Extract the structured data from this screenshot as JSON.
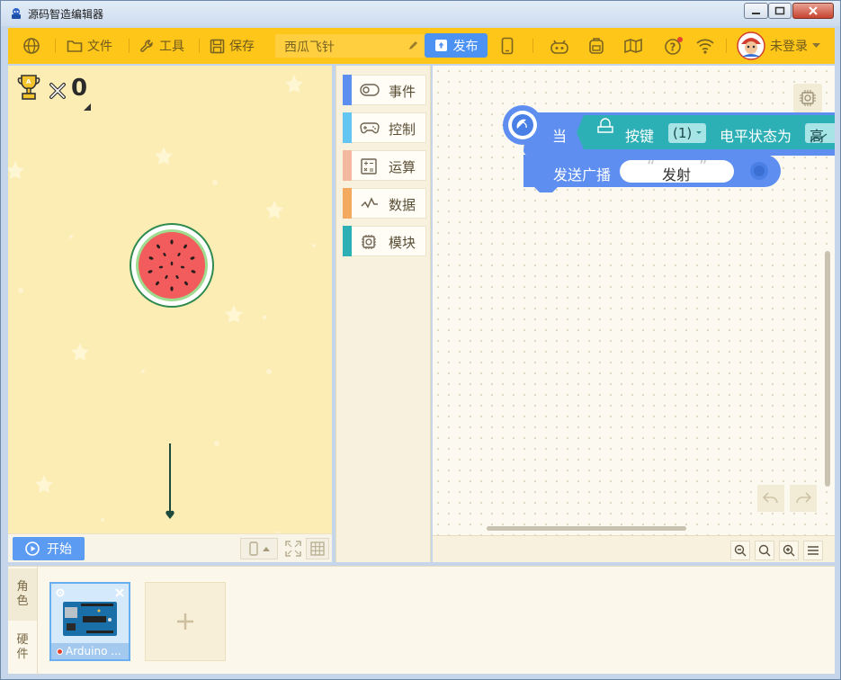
{
  "window": {
    "title": "源码智造编辑器"
  },
  "toolbar": {
    "file_label": "文件",
    "tools_label": "工具",
    "save_label": "保存",
    "project_name": "西瓜飞针",
    "publish_label": "发布",
    "login_label": "未登录"
  },
  "stage": {
    "trophy_count": "0",
    "start_label": "开始"
  },
  "categories": [
    {
      "label": "事件",
      "color": "#5d8ef0"
    },
    {
      "label": "控制",
      "color": "#63c6f2"
    },
    {
      "label": "运算",
      "color": "#f4b8a1"
    },
    {
      "label": "数据",
      "color": "#f3aa5e"
    },
    {
      "label": "模块",
      "color": "#2db0b5"
    }
  ],
  "blocks": {
    "when_label": "当",
    "button_label": "按键",
    "button_value": "(1)",
    "level_label": "电平状态为",
    "level_value": "高",
    "broadcast_label": "发送广播",
    "broadcast_value": "发射"
  },
  "bottom": {
    "tab_role": "角色",
    "tab_hardware": "硬件",
    "device_name": "Arduino ..."
  },
  "colors": {
    "toolbar": "#ffc61a",
    "publish": "#4b92f2",
    "event_block": "#5d8ef0",
    "sensor_block": "#2db0b5"
  }
}
